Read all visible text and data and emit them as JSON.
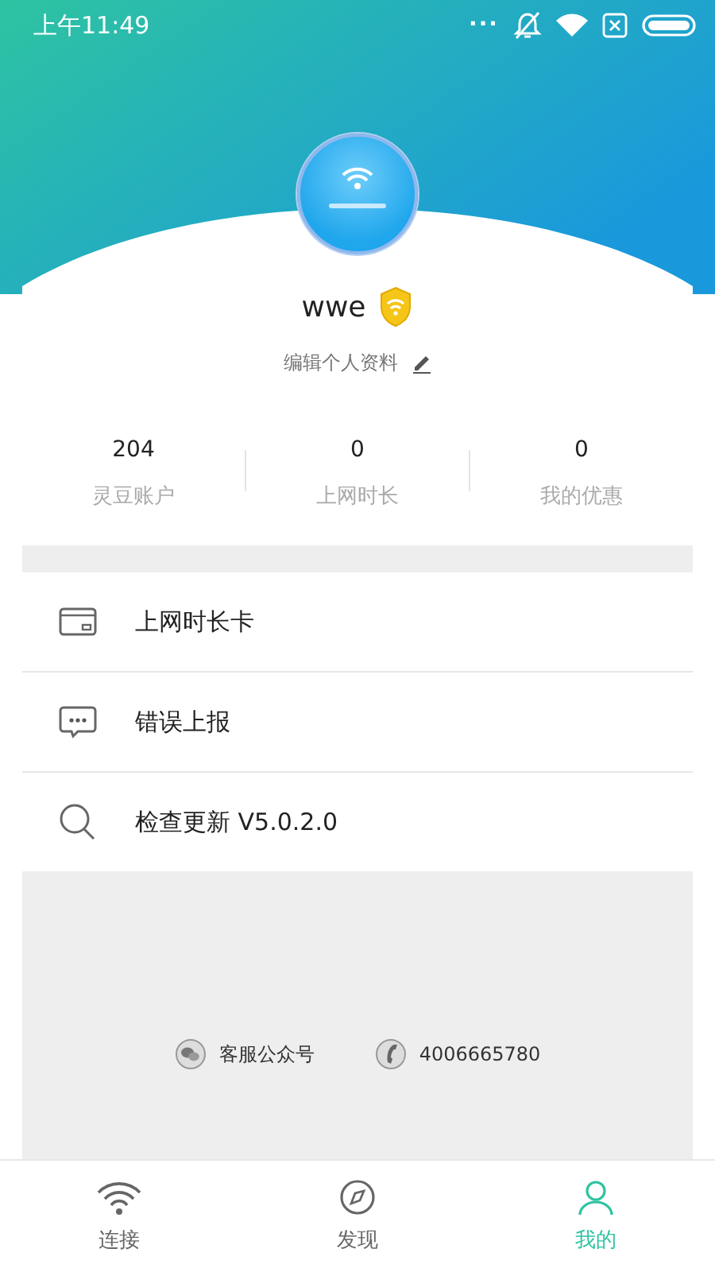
{
  "status_bar": {
    "time": "上午11:49",
    "dots": "..."
  },
  "profile": {
    "name": "wwe",
    "edit_label": "编辑个人资料"
  },
  "stats": [
    {
      "value": "204",
      "label": "灵豆账户"
    },
    {
      "value": "0",
      "label": "上网时长"
    },
    {
      "value": "0",
      "label": "我的优惠"
    }
  ],
  "menu": [
    {
      "kind": "card",
      "label": "上网时长卡"
    },
    {
      "kind": "chat",
      "label": "错误上报"
    },
    {
      "kind": "search",
      "label": "检查更新 V5.0.2.0"
    }
  ],
  "contacts": [
    {
      "kind": "wechat",
      "label": "客服公众号"
    },
    {
      "kind": "phone",
      "label": "4006665780"
    }
  ],
  "tabs": [
    {
      "kind": "wifi",
      "label": "连接",
      "selected": false
    },
    {
      "kind": "discover",
      "label": "发现",
      "selected": false
    },
    {
      "kind": "me",
      "label": "我的",
      "selected": true
    }
  ]
}
